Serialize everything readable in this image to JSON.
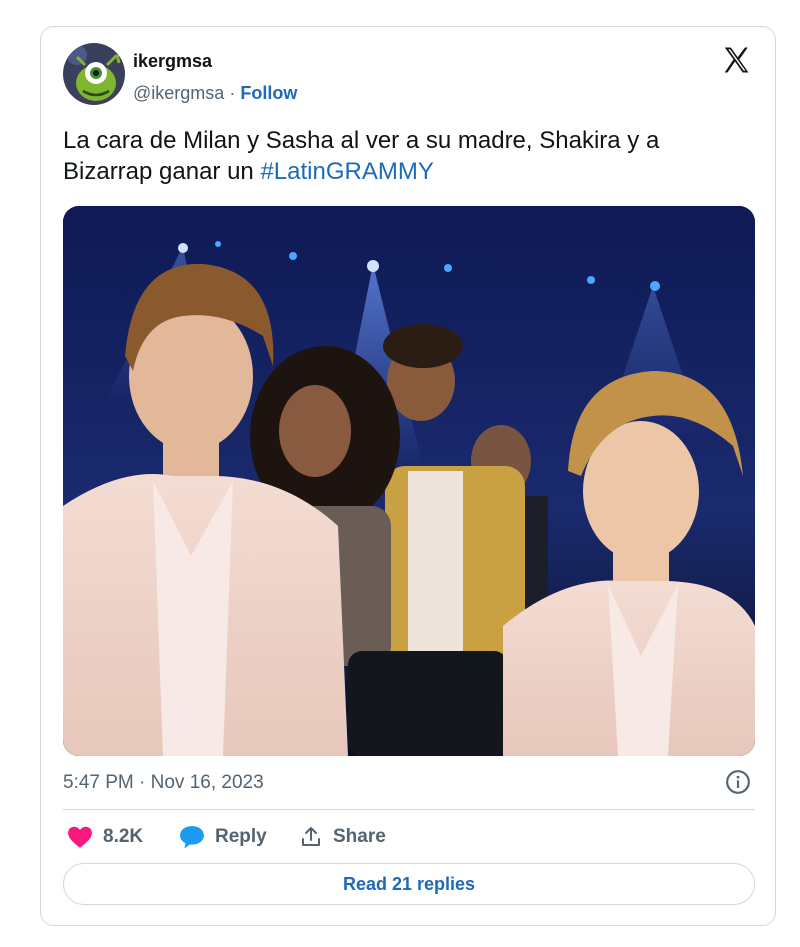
{
  "tweet": {
    "author": {
      "name": "ikergmsa",
      "handle": "@ikergmsa",
      "separator": "·",
      "follow_label": "Follow",
      "avatar_icon": "green-alien-avatar"
    },
    "text_before": "La cara de Milan y Sasha al ver a su madre, Shakira y a Bizarrap ganar un ",
    "hashtag": "#LatinGRAMMY",
    "timestamp": "5:47 PM · Nov 16, 2023",
    "actions": {
      "like_count": "8.2K",
      "reply_label": "Reply",
      "share_label": "Share"
    },
    "read_replies_label": "Read 21 replies"
  },
  "colors": {
    "link": "#1d6bb8",
    "like": "#f91880",
    "reply": "#1d9bf0",
    "muted": "#536471",
    "border": "#cfd9de"
  },
  "icons": [
    "x-logo-icon",
    "info-icon",
    "heart-icon",
    "speech-bubble-icon",
    "share-icon"
  ]
}
